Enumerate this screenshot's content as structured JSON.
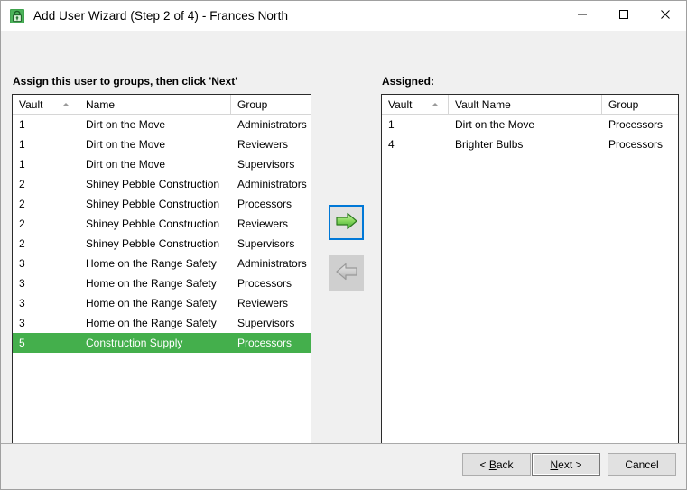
{
  "window": {
    "title": "Add User Wizard (Step 2 of 4) - Frances North",
    "icon": "vault-lock-icon",
    "controls": {
      "minimize": "minimize-icon",
      "maximize": "maximize-icon",
      "close": "close-icon"
    }
  },
  "left_panel": {
    "label": "Assign this user to groups, then click 'Next'",
    "columns": [
      "Vault",
      "Name",
      "Group"
    ],
    "sort_column": "Vault",
    "sort_direction": "ascending",
    "rows": [
      {
        "vault": "1",
        "name": "Dirt on the Move",
        "group": "Administrators",
        "selected": false
      },
      {
        "vault": "1",
        "name": "Dirt on the Move",
        "group": "Reviewers",
        "selected": false
      },
      {
        "vault": "1",
        "name": "Dirt on the Move",
        "group": "Supervisors",
        "selected": false
      },
      {
        "vault": "2",
        "name": "Shiney Pebble Construction",
        "group": "Administrators",
        "selected": false
      },
      {
        "vault": "2",
        "name": "Shiney Pebble Construction",
        "group": "Processors",
        "selected": false
      },
      {
        "vault": "2",
        "name": "Shiney Pebble Construction",
        "group": "Reviewers",
        "selected": false
      },
      {
        "vault": "2",
        "name": "Shiney Pebble Construction",
        "group": "Supervisors",
        "selected": false
      },
      {
        "vault": "3",
        "name": "Home on the Range Safety",
        "group": "Administrators",
        "selected": false
      },
      {
        "vault": "3",
        "name": "Home on the Range Safety",
        "group": "Processors",
        "selected": false
      },
      {
        "vault": "3",
        "name": "Home on the Range Safety",
        "group": "Reviewers",
        "selected": false
      },
      {
        "vault": "3",
        "name": "Home on the Range Safety",
        "group": "Supervisors",
        "selected": false
      },
      {
        "vault": "5",
        "name": "Construction Supply",
        "group": "Processors",
        "selected": true
      }
    ]
  },
  "right_panel": {
    "label": "Assigned:",
    "columns": [
      "Vault",
      "Vault Name",
      "Group"
    ],
    "sort_column": "Vault",
    "sort_direction": "ascending",
    "rows": [
      {
        "vault": "1",
        "name": "Dirt on the Move",
        "group": "Processors"
      },
      {
        "vault": "4",
        "name": "Brighter Bulbs",
        "group": "Processors"
      }
    ]
  },
  "transfer": {
    "add": {
      "icon": "arrow-right-icon",
      "enabled": true,
      "focused": true
    },
    "remove": {
      "icon": "arrow-left-icon",
      "enabled": false,
      "focused": false
    }
  },
  "footer": {
    "back": {
      "prefix": "< ",
      "accel": "B",
      "suffix": "ack"
    },
    "next": {
      "prefix": "",
      "accel": "N",
      "suffix": "ext >"
    },
    "cancel": "Cancel"
  },
  "colors": {
    "selection_green": "#44af4c",
    "focus_blue": "#0078d7",
    "window_bg": "#f0f0f0",
    "titlebar_bg": "#ffffff"
  }
}
